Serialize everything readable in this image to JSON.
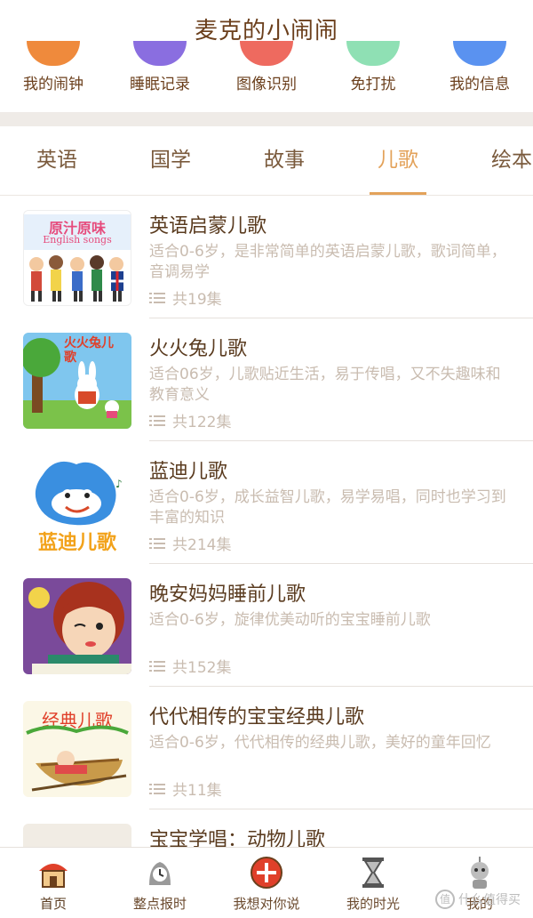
{
  "header": {
    "title": "麦克的小闹闹"
  },
  "quick": [
    {
      "label": "我的闹钟",
      "color": "#ef8a3c"
    },
    {
      "label": "睡眠记录",
      "color": "#8a6ee0"
    },
    {
      "label": "图像识别",
      "color": "#ee6a5f"
    },
    {
      "label": "免打扰",
      "color": "#8fe0b4"
    },
    {
      "label": "我的信息",
      "color": "#5a92f0"
    }
  ],
  "tabs": [
    {
      "label": "英语"
    },
    {
      "label": "国学"
    },
    {
      "label": "故事"
    },
    {
      "label": "儿歌",
      "active": true
    },
    {
      "label": "绘本"
    }
  ],
  "list": [
    {
      "title": "英语启蒙儿歌",
      "desc": "适合0-6岁，是非常简单的英语启蒙儿歌，歌词简单，音调易学",
      "count": "共19集",
      "thumb_text": "原汁原味",
      "thumb_sub": "English songs"
    },
    {
      "title": "火火兔儿歌",
      "desc": "适合06岁，儿歌贴近生活，易于传唱，又不失趣味和教育意义",
      "count": "共122集",
      "thumb_text": "火火兔儿歌"
    },
    {
      "title": "蓝迪儿歌",
      "desc": "适合0-6岁，成长益智儿歌，易学易唱，同时也学习到丰富的知识",
      "count": "共214集",
      "thumb_text": "蓝迪儿歌"
    },
    {
      "title": "晚安妈妈睡前儿歌",
      "desc": "适合0-6岁，旋律优美动听的宝宝睡前儿歌",
      "count": "共152集"
    },
    {
      "title": "代代相传的宝宝经典儿歌",
      "desc": "适合0-6岁，代代相传的经典儿歌，美好的童年回忆",
      "count": "共11集",
      "thumb_text": "经典儿歌"
    },
    {
      "title": "宝宝学唱：动物儿歌",
      "desc": "",
      "count": ""
    }
  ],
  "nav": [
    {
      "label": "首页",
      "icon": "home-icon",
      "active": true
    },
    {
      "label": "整点报时",
      "icon": "clock-bell-icon"
    },
    {
      "label": "我想对你说",
      "icon": "message-plus-icon"
    },
    {
      "label": "我的时光",
      "icon": "hourglass-icon"
    },
    {
      "label": "我的",
      "icon": "robot-icon"
    }
  ],
  "watermark": {
    "badge": "值",
    "text": "什么值得买"
  }
}
